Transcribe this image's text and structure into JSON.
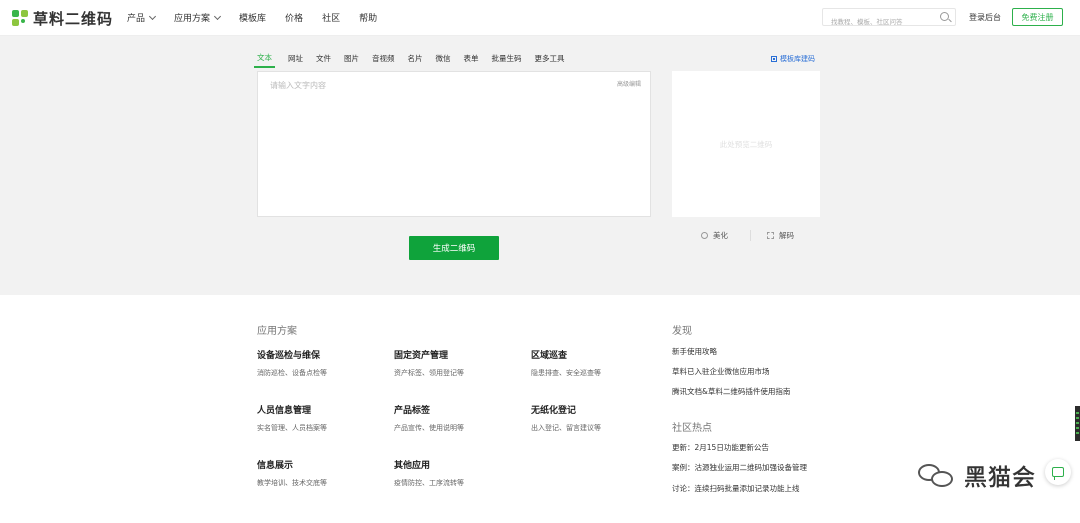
{
  "header": {
    "logo_text": "草料二维码",
    "nav": [
      {
        "label": "产品",
        "has_dropdown": true
      },
      {
        "label": "应用方案",
        "has_dropdown": true
      },
      {
        "label": "模板库",
        "has_dropdown": false
      },
      {
        "label": "价格",
        "has_dropdown": false
      },
      {
        "label": "社区",
        "has_dropdown": false
      },
      {
        "label": "帮助",
        "has_dropdown": false
      }
    ],
    "search_placeholder": "找教程、模板、社区问答",
    "login_label": "登录后台",
    "register_label": "免费注册"
  },
  "generator": {
    "tabs": [
      "文本",
      "网址",
      "文件",
      "图片",
      "音视频",
      "名片",
      "微信",
      "表单",
      "批量生码",
      "更多工具"
    ],
    "active_tab": "文本",
    "template_link": "模板库建码",
    "text_placeholder": "请输入文字内容",
    "advanced_label": "高级编辑",
    "generate_label": "生成二维码",
    "preview_placeholder": "此处预览二维码",
    "beautify_label": "美化",
    "decode_label": "解码"
  },
  "solutions": {
    "title": "应用方案",
    "items": [
      {
        "title": "设备巡检与维保",
        "desc": "消防巡检、设备点检等"
      },
      {
        "title": "固定资产管理",
        "desc": "资产标签、领用登记等"
      },
      {
        "title": "区域巡查",
        "desc": "隐患排查、安全巡查等"
      },
      {
        "title": "人员信息管理",
        "desc": "实名管理、人员档案等"
      },
      {
        "title": "产品标签",
        "desc": "产品宣传、使用说明等"
      },
      {
        "title": "无纸化登记",
        "desc": "出入登记、留言建议等"
      },
      {
        "title": "信息展示",
        "desc": "教学培训、技术交底等"
      },
      {
        "title": "其他应用",
        "desc": "疫情防控、工序流转等"
      }
    ]
  },
  "discover": {
    "title": "发现",
    "links": [
      "新手使用攻略",
      "草料已入驻企业微信应用市场",
      "腾讯文档&草料二维码插件使用指南"
    ]
  },
  "community": {
    "title": "社区热点",
    "links": [
      "更新：2月15日功能更新公告",
      "案例：沽源独业运用二维码加强设备管理",
      "讨论：连续扫码批量添加记录功能上线"
    ]
  },
  "watermark": {
    "text": "黑猫会"
  },
  "colors": {
    "brand_green": "#2db04b",
    "button_green": "#0fa33b",
    "link_blue": "#2a6fd6",
    "panel_gray": "#f2f2f2"
  }
}
